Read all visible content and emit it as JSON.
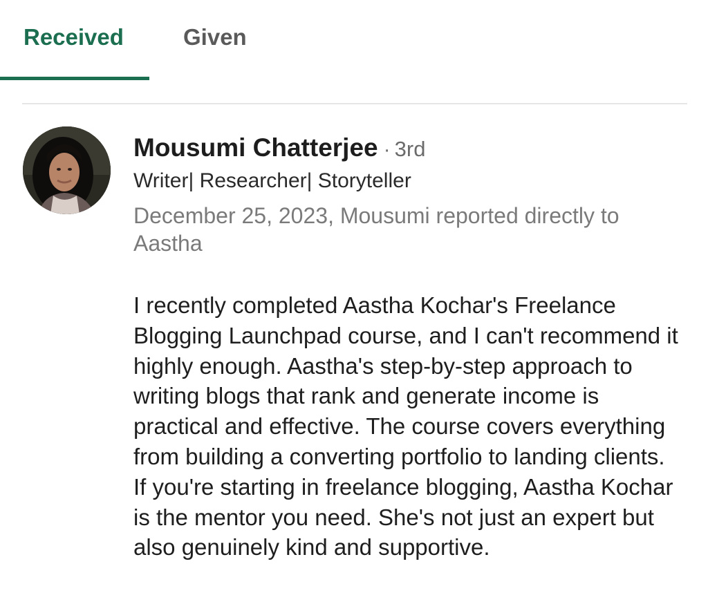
{
  "tabs": {
    "received_label": "Received",
    "given_label": "Given",
    "active": "Received",
    "accent_color": "#1b6e50"
  },
  "recommendation": {
    "author": {
      "name": "Mousumi Chatterjee",
      "separator": "·",
      "degree": "3rd",
      "headline": "Writer| Researcher| Storyteller",
      "avatar_icon": "profile-photo"
    },
    "meta": "December 25, 2023, Mousumi reported directly to Aastha",
    "text": "I recently completed Aastha Kochar's Freelance Blogging Launchpad course, and I can't recommend it highly enough. Aastha's step-by-step approach to writing blogs that rank and generate income is practical and effective. The course covers everything from building a converting portfolio to landing clients. If you're starting in freelance blogging, Aastha Kochar is the mentor you need. She's not just an expert but also genuinely kind and supportive."
  }
}
